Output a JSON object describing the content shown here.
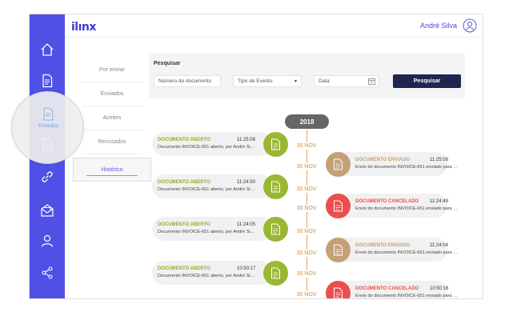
{
  "app": {
    "logo": "ilınx"
  },
  "user": {
    "name": "André Silva"
  },
  "sidebar": {
    "items": [
      {
        "icon": "home-icon"
      },
      {
        "icon": "document-icon"
      },
      {
        "icon": "sent-document-icon",
        "label": "Emitidos"
      },
      {
        "icon": "received-document-icon"
      },
      {
        "icon": "link-icon"
      },
      {
        "icon": "envelope-icon"
      },
      {
        "icon": "user-icon"
      },
      {
        "icon": "share-icon"
      }
    ]
  },
  "subnav": {
    "items": [
      "Por enviar",
      "Enviados",
      "Aceites",
      "Recusados",
      "Histórico"
    ],
    "active": "Histórico"
  },
  "search": {
    "title": "Pesquisar",
    "document_placeholder": "Número do documento",
    "event_type_value": "Tipo de Evento",
    "date_placeholder": "Data",
    "button_label": "Pesquisar"
  },
  "timeline": {
    "year": "2018",
    "dates": [
      "30 NOV",
      "30 NOV",
      "30 NOV",
      "30 NOV",
      "30 NOV",
      "30 NOV",
      "30 NOV",
      "30 NOV"
    ],
    "events": [
      {
        "side": "left",
        "title": "DOCUMENTO ABERTO",
        "time": "11:25:08",
        "desc": "Documento INVOICE-651 aberto, por André Silva",
        "color": "#9ab734"
      },
      {
        "side": "right",
        "title": "DOCUMENTO ENVIADO",
        "time": "11:25:08",
        "desc": "Envio do documento INVOICE-651 enviado para a entidade",
        "color": "#c4a077"
      },
      {
        "side": "left",
        "title": "DOCUMENTO ABERTO",
        "time": "11:24:50",
        "desc": "Documento INVOICE-651 aberto, por André Silva",
        "color": "#9ab734"
      },
      {
        "side": "right",
        "title": "DOCUMENTO CANCELADO",
        "time": "11:24:49",
        "desc": "Envio do documento INVOICE-651 enviado para a entidade",
        "color": "#ec4e4e"
      },
      {
        "side": "left",
        "title": "DOCUMENTO ABERTO",
        "time": "11:24:05",
        "desc": "Documento INVOICE-651 aberto, por André Silva",
        "color": "#9ab734"
      },
      {
        "side": "right",
        "title": "DOCUMENTO ENVIADO",
        "time": "11:24:04",
        "desc": "Envio do documento INVOICE-651 enviado para a entidade",
        "color": "#c4a077"
      },
      {
        "side": "left",
        "title": "DOCUMENTO ABERTO",
        "time": "10:50:17",
        "desc": "Documento INVOICE-651 aberto, por André Silva",
        "color": "#9ab734"
      },
      {
        "side": "right",
        "title": "DOCUMENTO CANCELADO",
        "time": "10:50:16",
        "desc": "Envio do documento INVOICE-651 enviado para a entidade",
        "color": "#ec4e4e"
      }
    ]
  },
  "colors": {
    "sidebar": "#5050e6",
    "accent": "#1e2551",
    "opened": "#9ab734",
    "sent": "#c4a077",
    "cancelled": "#ec4e4e"
  }
}
